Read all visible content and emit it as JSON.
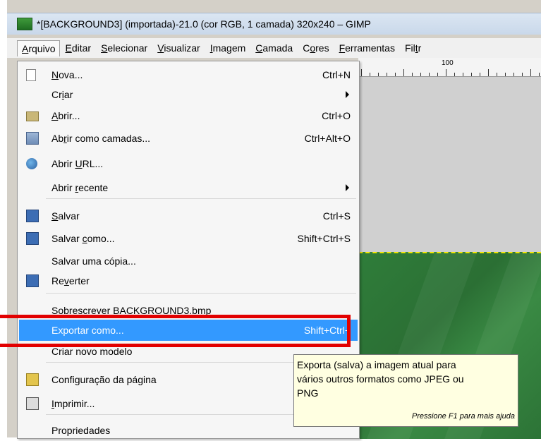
{
  "window": {
    "title": "*[BACKGROUND3] (importada)-21.0 (cor RGB, 1 camada) 320x240 – GIMP"
  },
  "menubar": [
    {
      "pre": "",
      "mn": "A",
      "post": "rquivo"
    },
    {
      "pre": "",
      "mn": "E",
      "post": "ditar"
    },
    {
      "pre": "",
      "mn": "S",
      "post": "elecionar"
    },
    {
      "pre": "",
      "mn": "V",
      "post": "isualizar"
    },
    {
      "pre": "",
      "mn": "I",
      "post": "magem"
    },
    {
      "pre": "",
      "mn": "C",
      "post": "amada"
    },
    {
      "pre": "C",
      "mn": "o",
      "post": "res"
    },
    {
      "pre": "",
      "mn": "F",
      "post": "erramentas"
    },
    {
      "pre": "Fil",
      "mn": "t",
      "post": "r"
    }
  ],
  "ruler": {
    "label": "100"
  },
  "file_menu": {
    "items": [
      {
        "pre": "",
        "mn": "N",
        "post": "ova...",
        "accel": "Ctrl+N",
        "icon": "new-file-icon"
      },
      {
        "pre": "Cr",
        "mn": "i",
        "post": "ar",
        "accel": "",
        "submenu": true
      },
      {
        "pre": "",
        "mn": "A",
        "post": "brir...",
        "accel": "Ctrl+O",
        "icon": "open-folder-icon"
      },
      {
        "pre": "Ab",
        "mn": "r",
        "post": "ir como camadas...",
        "accel": "Ctrl+Alt+O",
        "icon": "open-layers-icon"
      },
      {
        "pre": "Abrir ",
        "mn": "U",
        "post": "RL...",
        "accel": "",
        "icon": "globe-icon"
      },
      {
        "pre": "Abrir ",
        "mn": "r",
        "post": "ecente",
        "accel": "",
        "submenu": true
      },
      {
        "pre": "",
        "mn": "S",
        "post": "alvar",
        "accel": "Ctrl+S",
        "icon": "save-icon"
      },
      {
        "pre": "Salvar ",
        "mn": "c",
        "post": "omo...",
        "accel": "Shift+Ctrl+S",
        "icon": "save-as-icon"
      },
      {
        "pre": "Salvar uma cópia...",
        "mn": "",
        "post": "",
        "accel": ""
      },
      {
        "pre": "Re",
        "mn": "v",
        "post": "erter",
        "accel": "",
        "icon": "revert-icon"
      },
      {
        "pre": "Sobrescrever BACKGROUND3.bmp",
        "mn": "",
        "post": "",
        "accel": ""
      },
      {
        "pre": "Exportar como...",
        "mn": "",
        "post": "",
        "accel": "Shift+Ctrl+",
        "highlighted": true
      },
      {
        "pre": "Criar novo modelo",
        "mn": "",
        "post": "",
        "accel": ""
      },
      {
        "pre": "Confi",
        "mn": "g",
        "post": "uração da página",
        "accel": "",
        "icon": "page-setup-icon"
      },
      {
        "pre": "",
        "mn": "I",
        "post": "mprimir...",
        "accel": "",
        "icon": "print-icon"
      },
      {
        "pre": "Propriedades",
        "mn": "",
        "post": "",
        "accel": ""
      }
    ]
  },
  "tooltip": {
    "line1": "Exporta (salva) a imagem atual para",
    "line2": "vários outros formatos como JPEG ou",
    "line3": "PNG",
    "hint": "Pressione F1 para mais ajuda"
  }
}
